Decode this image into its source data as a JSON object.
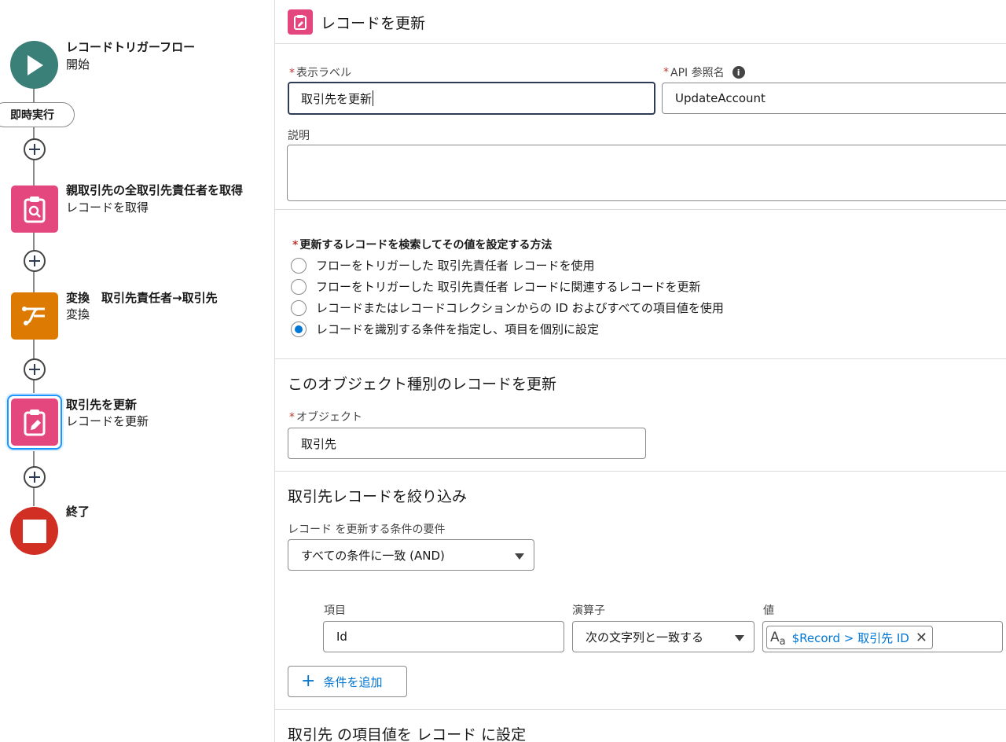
{
  "flow": {
    "start": {
      "title": "レコードトリガーフロー",
      "subtitle": "開始"
    },
    "run_pill": "即時実行",
    "get_records": {
      "title": "親取引先の全取引先責任者を取得",
      "subtitle": "レコードを取得"
    },
    "transform": {
      "title": "変換　取引先責任者→取引先",
      "subtitle": "変換"
    },
    "update": {
      "title": "取引先を更新",
      "subtitle": "レコードを更新"
    },
    "end": {
      "title": "終了"
    }
  },
  "panel": {
    "header_title": "レコードを更新",
    "display_label": {
      "label": "表示ラベル",
      "value": "取引先を更新"
    },
    "api_name": {
      "label": "API 参照名",
      "value": "UpdateAccount"
    },
    "description": {
      "label": "説明",
      "value": ""
    },
    "method": {
      "label": "更新するレコードを検索してその値を設定する方法",
      "options": [
        "フローをトリガーした 取引先責任者 レコードを使用",
        "フローをトリガーした 取引先責任者 レコードに関連するレコードを更新",
        "レコードまたはレコードコレクションからの ID およびすべての項目値を使用",
        "レコードを識別する条件を指定し、項目を個別に設定"
      ],
      "selected_index": 3
    },
    "object_section": {
      "title": "このオブジェクト種別のレコードを更新",
      "object_label": "オブジェクト",
      "object_value": "取引先"
    },
    "filter_section": {
      "title": "取引先レコードを絞り込み",
      "requirement_label": "レコード を更新する条件の要件",
      "requirement_value": "すべての条件に一致 (AND)",
      "field_label": "項目",
      "operator_label": "演算子",
      "value_label": "値",
      "field_value": "Id",
      "operator_value": "次の文字列と一致する",
      "value_tag": "$Record > 取引先 ID",
      "add_condition": "条件を追加"
    },
    "set_section": {
      "title": "取引先 の項目値を レコード に設定"
    }
  },
  "colors": {
    "start": "#3a7f78",
    "get": "#e3477d",
    "transform": "#dd7a01",
    "update": "#e3477d",
    "end": "#d12e24",
    "accent": "#0176d3"
  }
}
